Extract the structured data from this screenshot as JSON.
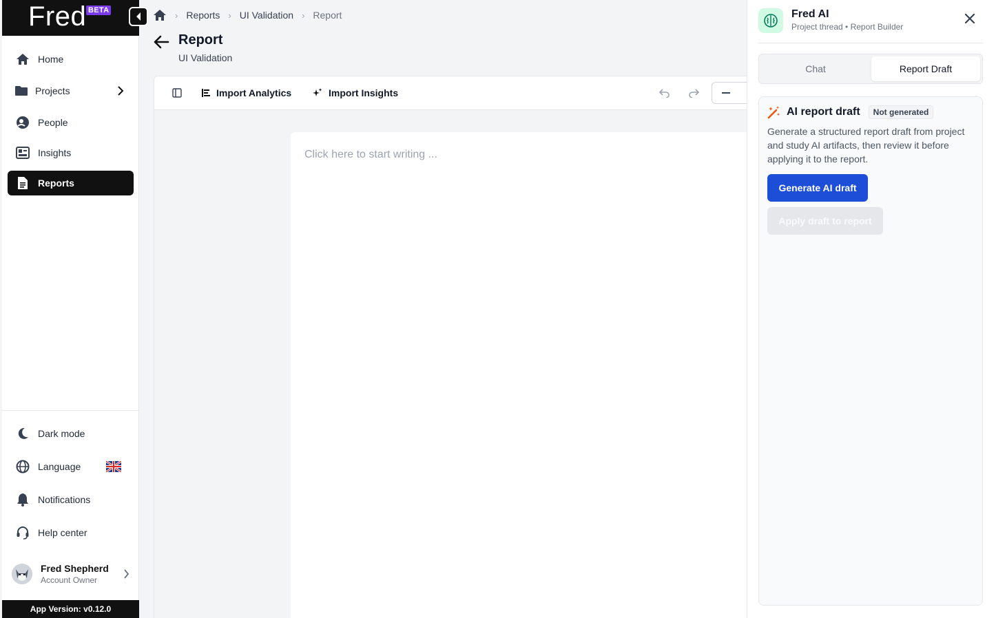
{
  "app": {
    "logo": "Fred",
    "badge": "BETA"
  },
  "sidebar": {
    "items": [
      {
        "label": "Home",
        "icon": "home-icon"
      },
      {
        "label": "Projects",
        "icon": "folder-icon"
      },
      {
        "label": "People",
        "icon": "people-icon"
      },
      {
        "label": "Insights",
        "icon": "insights-icon"
      },
      {
        "label": "Reports",
        "icon": "report-icon",
        "active": true
      }
    ],
    "bottom": [
      {
        "label": "Dark mode",
        "icon": "moon-icon"
      },
      {
        "label": "Language",
        "icon": "globe-icon"
      },
      {
        "label": "Notifications",
        "icon": "bell-icon"
      },
      {
        "label": "Help center",
        "icon": "headset-icon"
      }
    ],
    "user": {
      "name": "Fred Shepherd",
      "role": "Account Owner"
    },
    "version": "App Version: v0.12.0"
  },
  "breadcrumb": [
    "Reports",
    "UI Validation",
    "Report"
  ],
  "header": {
    "title": "Report",
    "subtitle": "UI Validation"
  },
  "toolbar": {
    "import_analytics": "Import Analytics",
    "import_insights": "Import Insights"
  },
  "editor": {
    "placeholder": "Click here to start writing ..."
  },
  "panel": {
    "title": "Fred AI",
    "subtitle": "Project thread • Report Builder",
    "tabs": [
      {
        "label": "Chat"
      },
      {
        "label": "Report Draft",
        "active": true
      }
    ],
    "draft": {
      "title": "AI report draft",
      "badge": "Not generated",
      "description": "Generate a structured report draft from project and study AI artifacts, then review it before applying it to the report.",
      "generate_label": "Generate AI draft",
      "apply_label": "Apply draft to report"
    }
  },
  "colors": {
    "accent": "#1d4ed8",
    "sidebar_dark": "#111111",
    "beta": "#7c3aed"
  }
}
